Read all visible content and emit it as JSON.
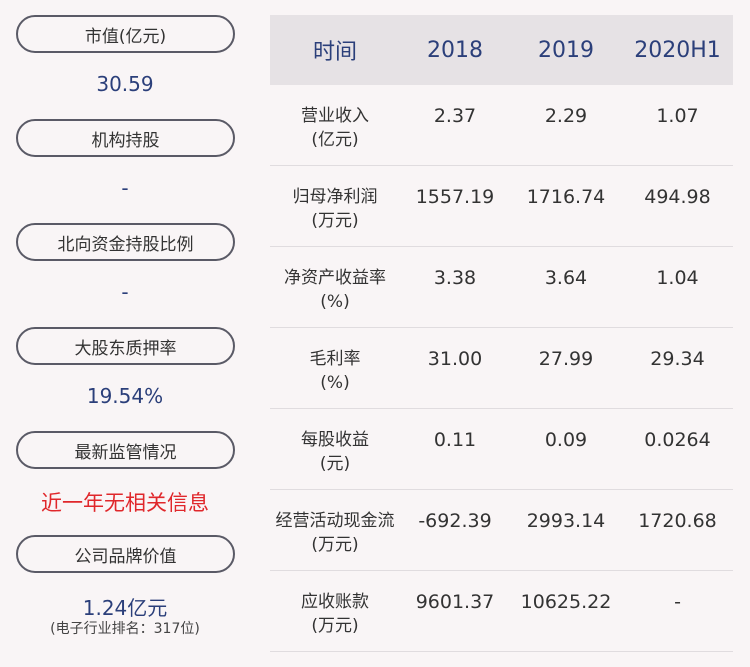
{
  "sidebar": {
    "items": [
      {
        "label": "市值(亿元)",
        "value": "30.59"
      },
      {
        "label": "机构持股",
        "value": "-"
      },
      {
        "label": "北向资金持股比例",
        "value": "-"
      },
      {
        "label": "大股东质押率",
        "value": "19.54%"
      },
      {
        "label": "最新监管情况",
        "value": "近一年无相关信息"
      },
      {
        "label": "公司品牌价值",
        "value": "1.24亿元",
        "note": "(电子行业排名：317位)"
      }
    ]
  },
  "table": {
    "header": [
      "时间",
      "2018",
      "2019",
      "2020H1"
    ],
    "rows": [
      {
        "name": "营业收入",
        "unit": "(亿元)",
        "v": [
          "2.37",
          "2.29",
          "1.07"
        ]
      },
      {
        "name": "归母净利润",
        "unit": "(万元)",
        "v": [
          "1557.19",
          "1716.74",
          "494.98"
        ]
      },
      {
        "name": "净资产收益率",
        "unit": "(%)",
        "v": [
          "3.38",
          "3.64",
          "1.04"
        ]
      },
      {
        "name": "毛利率",
        "unit": "(%)",
        "v": [
          "31.00",
          "27.99",
          "29.34"
        ]
      },
      {
        "name": "每股收益",
        "unit": "(元)",
        "v": [
          "0.11",
          "0.09",
          "0.0264"
        ]
      },
      {
        "name": "经营活动现金流",
        "unit": "(万元)",
        "v": [
          "-692.39",
          "2993.14",
          "1720.68"
        ]
      },
      {
        "name": "应收账款",
        "unit": "(万元)",
        "v": [
          "9601.37",
          "10625.22",
          "-"
        ]
      }
    ]
  },
  "colors": {
    "accent": "#2b3f7a",
    "alert": "#e0272b",
    "background": "#f9f5f6",
    "header_bg": "#e6e2e5"
  }
}
